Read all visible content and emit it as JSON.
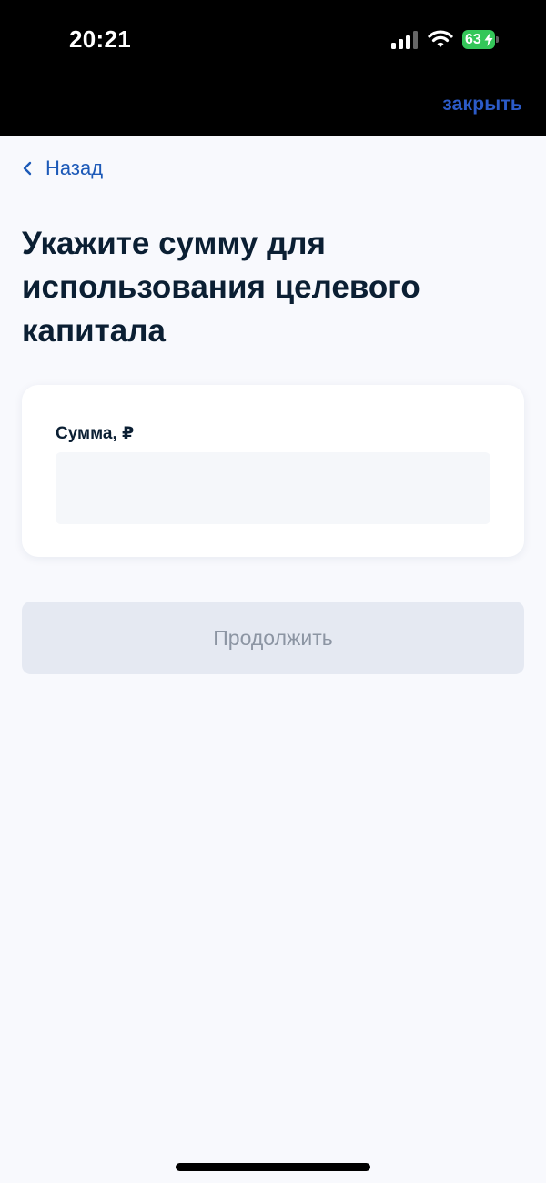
{
  "status_bar": {
    "time": "20:21",
    "battery_level": "63",
    "battery_color": "#34c759"
  },
  "header": {
    "close_label": "закрыть"
  },
  "nav": {
    "back_label": "Назад",
    "back_icon": "chevron-left-icon"
  },
  "page": {
    "title": "Укажите сумму для использования целевого капитала"
  },
  "form": {
    "amount_label": "Сумма, ₽",
    "amount_value": "",
    "amount_placeholder": ""
  },
  "actions": {
    "continue_label": "Продолжить",
    "continue_state": "disabled"
  },
  "colors": {
    "accent": "#1d5ab8",
    "title": "#0b1f33",
    "background": "#f8f9fd"
  }
}
